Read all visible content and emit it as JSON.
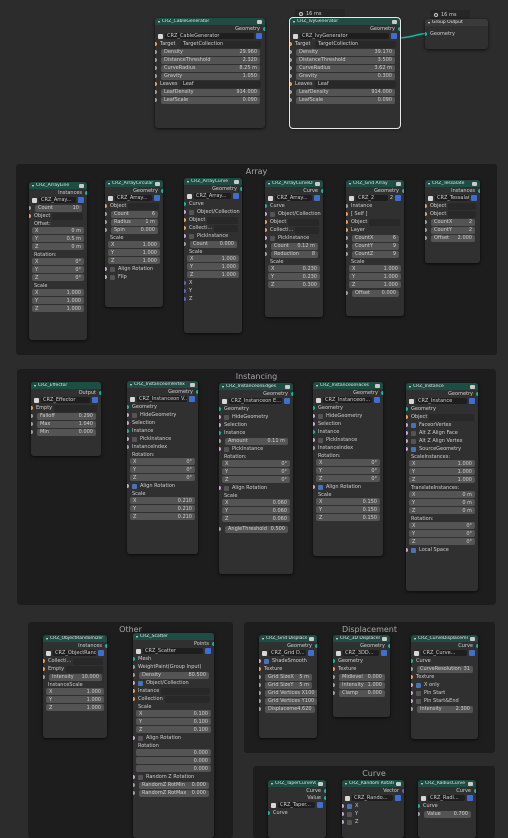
{
  "timings": [
    "16 ms",
    "16 ms"
  ],
  "group_output": {
    "title": "Group Output",
    "socket": "Geometry"
  },
  "frames": {
    "array": "Array",
    "instancing": "Instancing",
    "other": "Other",
    "displacement": "Displacement",
    "curve": "Curve"
  },
  "common": {
    "geometry": "Geometry",
    "instances": "Instances",
    "points": "Points",
    "output": "Output",
    "curve": "Curve",
    "value": "Value",
    "vector": "Vector",
    "x": "X",
    "y": "Y",
    "z": "Z"
  },
  "cable": {
    "title": "CRZ_CableGenerator",
    "group": "CRZ_CableGenerator",
    "target_label": "Target",
    "target_value": "TargetCollection",
    "fields": [
      [
        "Density",
        "29.960"
      ],
      [
        "DistanceThreshold",
        "2.320"
      ],
      [
        "CurveRadius",
        "8.25 m"
      ],
      [
        "Gravity",
        "1.050"
      ]
    ],
    "leaves_label": "Leaves",
    "leaves_value": "Leaf",
    "leaves2": [
      [
        "LeafDensity",
        "914.000"
      ],
      [
        "LeafScale",
        "0.090"
      ]
    ]
  },
  "ivy": {
    "title": "CRZ_IvyGenerator",
    "group": "CRZ_IvyGenerator",
    "target_label": "Target",
    "target_value": "TargetCollection",
    "fields": [
      [
        "Density",
        "39.170"
      ],
      [
        "DistanceThreshold",
        "3.500"
      ],
      [
        "CurveRadius",
        "3.62 m"
      ],
      [
        "Gravity",
        "0.300"
      ]
    ],
    "leaves_label": "Leaves",
    "leaves_value": "Leaf",
    "leaves2": [
      [
        "LeafDensity",
        "914.000"
      ],
      [
        "LeafScale",
        "0.090"
      ]
    ]
  },
  "arr_line": {
    "title": "CRZ_ArrayLine",
    "group": "CRZ_Array...",
    "count_label": "Count",
    "count": "10",
    "object": "Object",
    "offset": "Offset:",
    "offset_vals": [
      "0 m",
      "0.5 m",
      "0 m"
    ],
    "rotation": "Rotation:",
    "rot_vals": [
      "0°",
      "0°",
      "0°"
    ],
    "scale": "Scale",
    "scale_vals": [
      "1.000",
      "1.000",
      "1.000"
    ]
  },
  "arr_circ": {
    "title": "CRZ_ArrayCircular",
    "group": "CRZ_Array...",
    "object": "Object",
    "fields": [
      [
        "Count",
        "6"
      ],
      [
        "Radius",
        "1 m"
      ],
      [
        "Spin",
        "0.000"
      ]
    ],
    "scale": "Scale",
    "scale_vals": [
      "1.000",
      "1.000",
      "1.000"
    ],
    "align": "Align Rotation",
    "flip": "Flip"
  },
  "arr_curve": {
    "title": "CRZ_ArrayCurve",
    "group": "CRZ_Array...",
    "curve": "Curve",
    "objcol": "Object/Collection",
    "object": "Object",
    "collection": "Collecti...",
    "pick": "PickInstance",
    "count_label": "Count",
    "count": "0.000",
    "scale": "Scale",
    "scale_vals": [
      "1.000",
      "1.000",
      "1.000"
    ]
  },
  "arr_curvedist": {
    "title": "CRZ_ArrayCurveDist",
    "group": "CRZ_Array...",
    "curve": "Curve",
    "objcol": "Object/Collection",
    "object": "Object",
    "collection": "Collecti...",
    "pick": "PickInstance",
    "count_label": "Count",
    "count": "0.12 m",
    "red_label": "Reduction",
    "red": "8",
    "scale": "Scale",
    "scale_vals": [
      "0.230",
      "0.230",
      "0.300"
    ]
  },
  "arr_grid": {
    "title": "CRZ_Grid Array",
    "group": "CRZ_2",
    "grp_num": "2",
    "instance": "Instance",
    "self": "[ Self ]",
    "object": "Object",
    "layer": "Layer",
    "fields": [
      [
        "CountX",
        "6"
      ],
      [
        "CountY",
        "9"
      ],
      [
        "CountZ",
        "9"
      ]
    ],
    "scale": "Scale",
    "scale_vals": [
      "1.000",
      "1.000",
      "1.000"
    ],
    "offset_label": "Offset",
    "offset": "0.000"
  },
  "arr_tess": {
    "title": "CRZ_Tessalate",
    "group": "CRZ_Tessalat...",
    "object": "Object",
    "object2": "Object",
    "fields": [
      [
        "CountX",
        "2"
      ],
      [
        "CountY",
        "2"
      ],
      [
        "Offset",
        "2.000"
      ]
    ]
  },
  "effector": {
    "title": "CRZ_Effector",
    "group": "CRZ_Effector",
    "empty": "Empty",
    "fields": [
      [
        "Falloff",
        "0.290"
      ],
      [
        "Max",
        "1.040"
      ],
      [
        "Min",
        "0.000"
      ]
    ]
  },
  "inst_vert": {
    "title": "CRZ_InstanceonVertex",
    "group": "CRZ_Instanceon V...",
    "geometry": "Geometry",
    "hide": "HideGeometry",
    "selection": "Selection",
    "instance": "Instance",
    "pick": "PickInstance",
    "index": "InstanceIndex",
    "rotation": "Rotation:",
    "rot_vals": [
      "0°",
      "0°",
      "0°"
    ],
    "align": "Align Rotation",
    "scale": "Scale",
    "scale_vals": [
      "0.210",
      "0.210",
      "0.210"
    ]
  },
  "inst_edge": {
    "title": "CRZ_InstanceonEdges",
    "group": "CRZ_Instanceon E...",
    "geometry": "Geometry",
    "hide": "HideGeometry",
    "selection": "Selection",
    "instance": "Instance",
    "amount_label": "Amount",
    "amount": "0.11 m",
    "pick": "PickInstance",
    "rotation": "Rotation:",
    "rot_vals": [
      "0°",
      "0°",
      "0°"
    ],
    "align": "Align Rotation",
    "scale": "Scale",
    "scale_vals": [
      "0.060",
      "0.060",
      "0.060"
    ],
    "angle_label": "AngleThreshold",
    "angle": "0.500"
  },
  "inst_face": {
    "title": "CRZ_InstanceonFaces",
    "group": "CRZ_Instanceon...",
    "geometry": "Geometry",
    "hide": "HideGeometry",
    "selection": "Selection",
    "instance": "Instance",
    "pick": "PickInstance",
    "index": "InstanceIndex",
    "rotation": "Rotation:",
    "rot_vals": [
      "0°",
      "0°",
      "0°"
    ],
    "align": "Align Rotation",
    "scale": "Scale",
    "scale_vals": [
      "0.150",
      "0.150",
      "0.150"
    ]
  },
  "instance": {
    "title": "CRZ_Instance",
    "group": "CRZ_Instance",
    "geometry": "Geometry",
    "object": "Object",
    "face": "FaceorVertex",
    "alt_face": "Alt Z Align Face",
    "alt_vert": "Alt Z Align Vertex",
    "source": "SourceGeometry",
    "scale": "ScaleInstances:",
    "scale_vals": [
      "1.000",
      "1.000",
      "1.000"
    ],
    "translate": "TranslateInstances:",
    "trans_vals": [
      "0 m",
      "0 m",
      "0 m"
    ],
    "rotation": "Rotation:",
    "rot_vals": [
      "0°",
      "0°",
      "0°"
    ],
    "local": "Local Space"
  },
  "obj_rand": {
    "title": "CRZ_ObjectRandomizer",
    "group": "CRZ_ObjectRando...",
    "collection": "Collecti...",
    "empty": "Empty",
    "intensity_label": "Intensity",
    "intensity": "10.000",
    "iscale": "InstanceScale",
    "scale_vals": [
      "1.000",
      "1.000",
      "1.000"
    ]
  },
  "scatter": {
    "title": "CRZ_Scatter",
    "group": "CRZ_Scatter",
    "mesh": "Mesh",
    "weight": "WeightPaint(Group Input)",
    "density_label": "Density",
    "density": "80.500",
    "objcol": "Object/Collection",
    "instance": "Instance",
    "collection": "Collection",
    "scale": "Scale",
    "scale_vals": [
      "0.100",
      "0.100",
      "0.100"
    ],
    "align": "Align Rotation",
    "rotation": "Rotation",
    "rot_vals": [
      "0.000",
      "0.000",
      "0.000"
    ],
    "random_z": "Random Z Rotation",
    "rz_min_label": "RandomZ RotMin",
    "rz_min": "0.000",
    "rz_max_label": "RandomZ RotMax",
    "rz_max": "0.000"
  },
  "grid_disp": {
    "title": "CRZ_Grid Displace",
    "group": "CRZ_Grid D...",
    "shade": "ShadeSmooth",
    "texture": "Texture",
    "fields": [
      [
        "Grid SizeX",
        "5 m"
      ],
      [
        "Grid SizeY",
        "5 m"
      ],
      [
        "Grid Vertices X",
        "100"
      ],
      [
        "Grid Vertices Y",
        "100"
      ],
      [
        "Displaceme",
        "4.620"
      ]
    ]
  },
  "disp_3d": {
    "title": "CRZ_3D Displacer",
    "group": "CRZ_3DD...",
    "geometry": "Geometry",
    "texture": "Texture",
    "fields": [
      [
        "Midlevel",
        "0.000"
      ],
      [
        "Intensity",
        "1.000"
      ],
      [
        "Clamp",
        "0.000"
      ]
    ]
  },
  "curve_disp": {
    "title": "CRZ_CurveDisplacement",
    "group": "CRZ_Curve...",
    "curve": "Curve",
    "res_label": "CurveResolution",
    "res": "31",
    "texture": "Texture",
    "xonly": "X only",
    "start": "Pin Start",
    "startend": "Pin Start&End",
    "intensity_label": "Intensity",
    "intensity": "2.300"
  },
  "taper": {
    "title": "CRZ_TaperCurveValue",
    "group": "CRZ_Taper...",
    "curve": "Curve"
  },
  "rand_rot": {
    "title": "CRZ_Random Rotate",
    "group": "CRZ_Rando..."
  },
  "radius": {
    "title": "CRZ_RadiusCurve",
    "group": "CRZ_Radi...",
    "curve": "Curve",
    "value": "0.700"
  }
}
